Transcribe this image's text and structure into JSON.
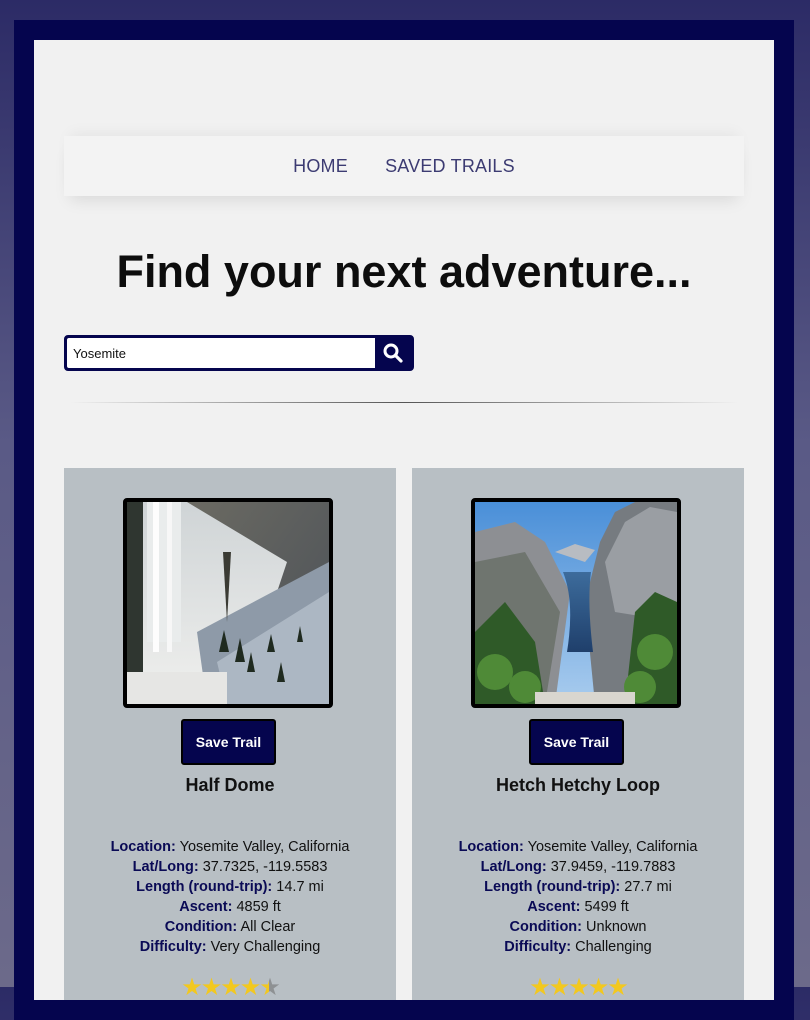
{
  "nav": {
    "home": "HOME",
    "saved": "SAVED TRAILS"
  },
  "headline": "Find your next adventure...",
  "search": {
    "value": "Yosemite",
    "icon": "search-icon"
  },
  "labels": {
    "location": "Location:",
    "latlong": "Lat/Long:",
    "length": "Length (round-trip):",
    "ascent": "Ascent:",
    "condition": "Condition:",
    "difficulty": "Difficulty:"
  },
  "colors": {
    "brand": "#05054e",
    "card_bg": "#b8bfc4",
    "panel_bg": "#f1f1f1",
    "star": "#f2c81f"
  },
  "trails": [
    {
      "save_label": "Save Trail",
      "name": "Half Dome",
      "location": "Yosemite Valley, California",
      "latlong": "37.7325, -119.5583",
      "length": "14.7 mi",
      "ascent": "4859 ft",
      "condition": "All Clear",
      "difficulty": "Very Challenging",
      "rating": 4.5
    },
    {
      "save_label": "Save Trail",
      "name": "Hetch Hetchy Loop",
      "location": "Yosemite Valley, California",
      "latlong": "37.9459, -119.7883",
      "length": "27.7 mi",
      "ascent": "5499 ft",
      "condition": "Unknown",
      "difficulty": "Challenging",
      "rating": 5
    }
  ]
}
